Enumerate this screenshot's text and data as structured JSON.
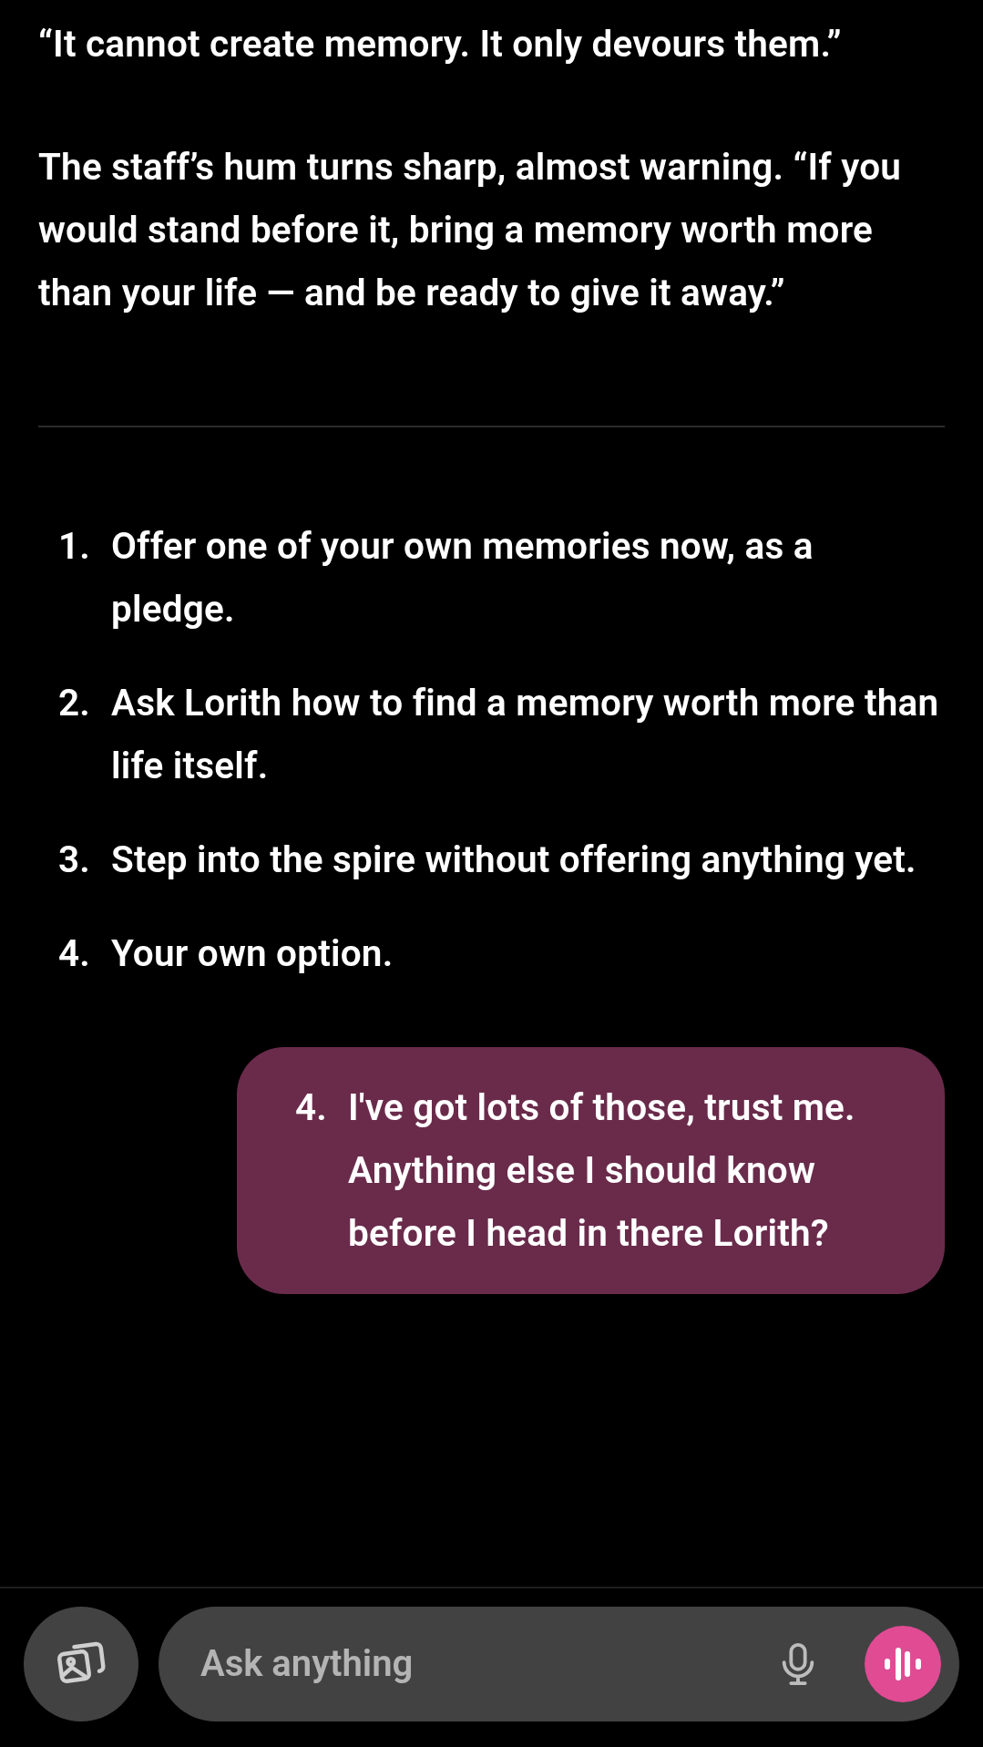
{
  "paragraphs": [
    "“It cannot create memory. It only devours them.”",
    "The staff’s hum turns sharp, almost warning. “If you would stand before it, bring a memory worth more than your life — and be ready to give it away.”"
  ],
  "options": [
    {
      "number": "1.",
      "text": "Offer one of your own memories now, as a pledge."
    },
    {
      "number": "2.",
      "text": "Ask Lorith how to find a memory worth more than life itself."
    },
    {
      "number": "3.",
      "text": "Step into the spire without offering anything yet."
    },
    {
      "number": "4.",
      "text": "Your own option."
    }
  ],
  "user_message": {
    "number": "4.",
    "text": "I've got lots of those, trust me. Anything else I should know before I head in there Lorith?"
  },
  "composer": {
    "placeholder": "Ask anything"
  }
}
